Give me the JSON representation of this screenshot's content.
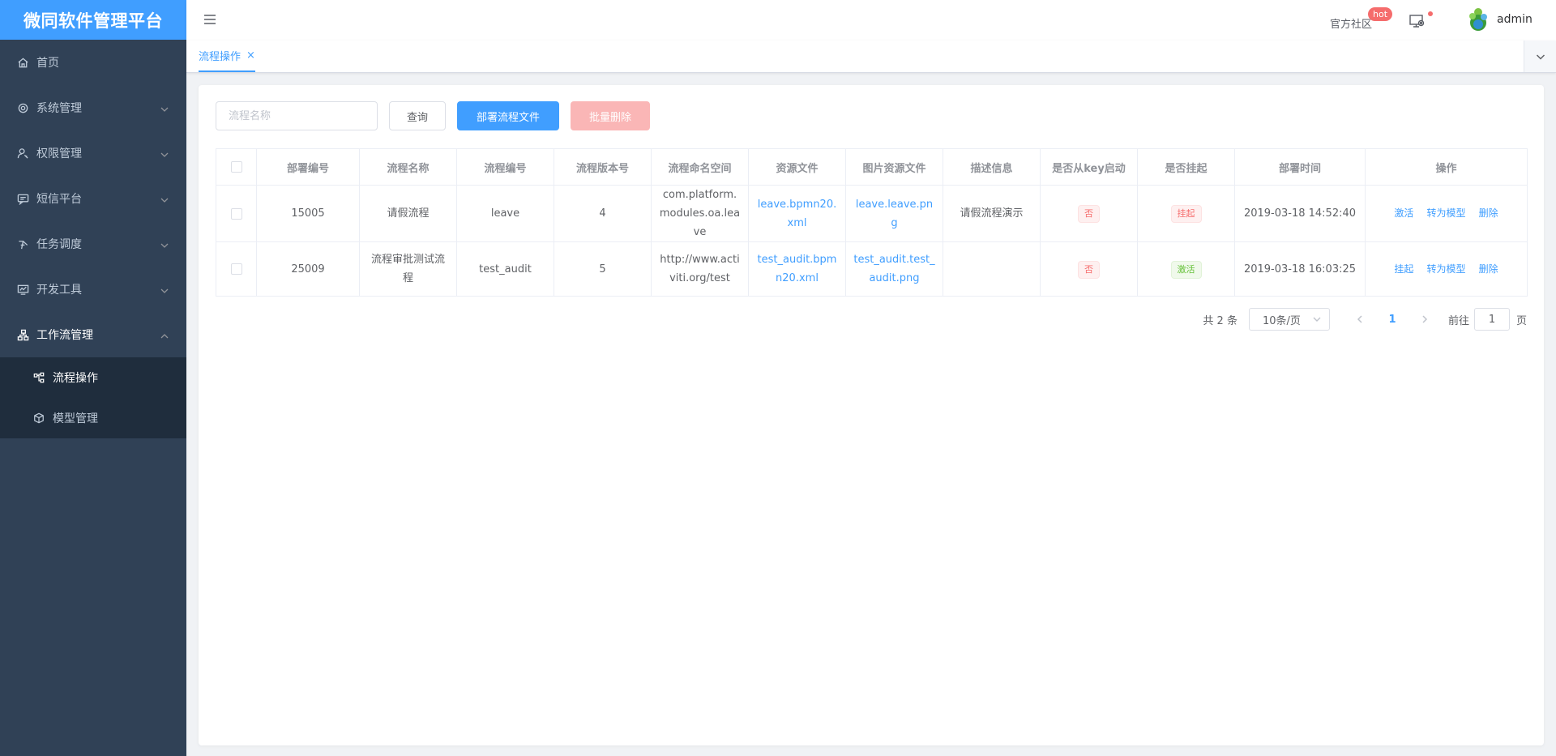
{
  "app": {
    "title": "微同软件管理平台"
  },
  "sidebar": {
    "items": [
      {
        "label": "首页",
        "icon": "home-icon"
      },
      {
        "label": "系统管理",
        "icon": "gear-icon"
      },
      {
        "label": "权限管理",
        "icon": "user-key-icon"
      },
      {
        "label": "短信平台",
        "icon": "message-icon"
      },
      {
        "label": "任务调度",
        "icon": "schedule-icon"
      },
      {
        "label": "开发工具",
        "icon": "monitor-icon"
      },
      {
        "label": "工作流管理",
        "icon": "workflow-icon"
      }
    ],
    "sub_items": [
      {
        "label": "流程操作",
        "icon": "process-icon",
        "active": true
      },
      {
        "label": "模型管理",
        "icon": "cube-icon",
        "active": false
      }
    ]
  },
  "header": {
    "community_label": "官方社区",
    "hot_badge": "hot",
    "username": "admin"
  },
  "tags": {
    "active_tag": "流程操作",
    "close_symbol": "×"
  },
  "toolbar": {
    "search_placeholder": "流程名称",
    "query_label": "查询",
    "deploy_label": "部署流程文件",
    "batch_delete_label": "批量删除"
  },
  "table": {
    "headers": [
      "部署编号",
      "流程名称",
      "流程编号",
      "流程版本号",
      "流程命名空间",
      "资源文件",
      "图片资源文件",
      "描述信息",
      "是否从key启动",
      "是否挂起",
      "部署时间",
      "操作"
    ],
    "rows": [
      {
        "deploy_id": "15005",
        "name": "请假流程",
        "key": "leave",
        "version": "4",
        "namespace": "com.platform.modules.oa.leave",
        "resource": "leave.bpmn20.xml",
        "image_resource": "leave.leave.png",
        "description": "请假流程演示",
        "from_key": "否",
        "suspended": "挂起",
        "deploy_time": "2019-03-18 14:52:40",
        "op_toggle": "激活",
        "op_convert": "转为模型",
        "op_delete": "删除"
      },
      {
        "deploy_id": "25009",
        "name": "流程审批测试流程",
        "key": "test_audit",
        "version": "5",
        "namespace": "http://www.activiti.org/test",
        "resource": "test_audit.bpmn20.xml",
        "image_resource": "test_audit.test_audit.png",
        "description": "",
        "from_key": "否",
        "suspended": "激活",
        "deploy_time": "2019-03-18 16:03:25",
        "op_toggle": "挂起",
        "op_convert": "转为模型",
        "op_delete": "删除"
      }
    ]
  },
  "pagination": {
    "total": "共 2 条",
    "page_size": "10条/页",
    "current_page": "1",
    "goto_label": "前往",
    "goto_value": "1",
    "page_suffix": "页"
  },
  "colors": {
    "primary": "#409eff",
    "sidebar_bg": "#304156",
    "danger": "#f56c6c",
    "success": "#67c23a"
  }
}
